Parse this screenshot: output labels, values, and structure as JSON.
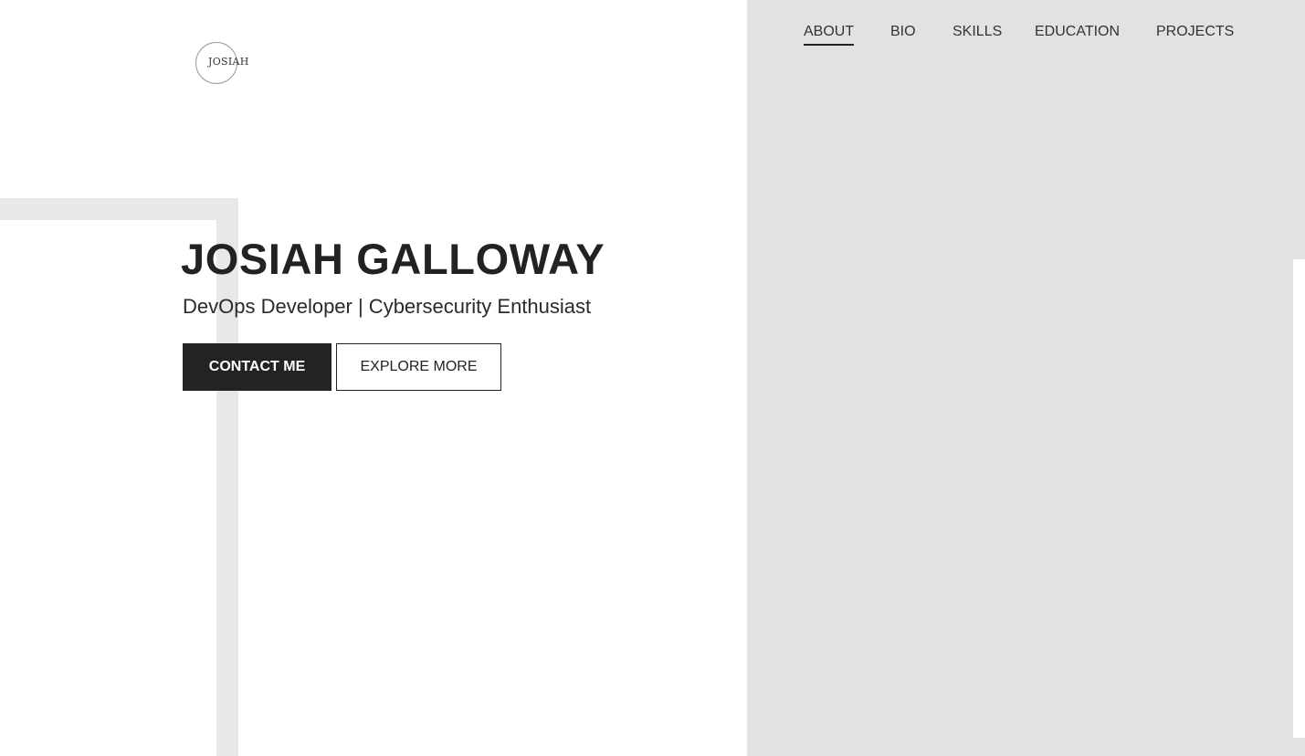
{
  "logo": {
    "text": "JOSIAH"
  },
  "nav": {
    "items": [
      {
        "label": "ABOUT",
        "active": true
      },
      {
        "label": "BIO",
        "active": false
      },
      {
        "label": "SKILLS",
        "active": false
      },
      {
        "label": "EDUCATION",
        "active": false
      },
      {
        "label": "PROJECTS",
        "active": false
      }
    ]
  },
  "hero": {
    "name": "JOSIAH GALLOWAY",
    "subtitle": "DevOps Developer | Cybersecurity Enthusiast",
    "contact_label": "CONTACT ME",
    "explore_label": "EXPLORE MORE"
  },
  "colors": {
    "primary_dark": "#232323",
    "panel_grey": "#e2e2e2",
    "frame_grey": "#e8e8e8",
    "background": "#ffffff"
  }
}
